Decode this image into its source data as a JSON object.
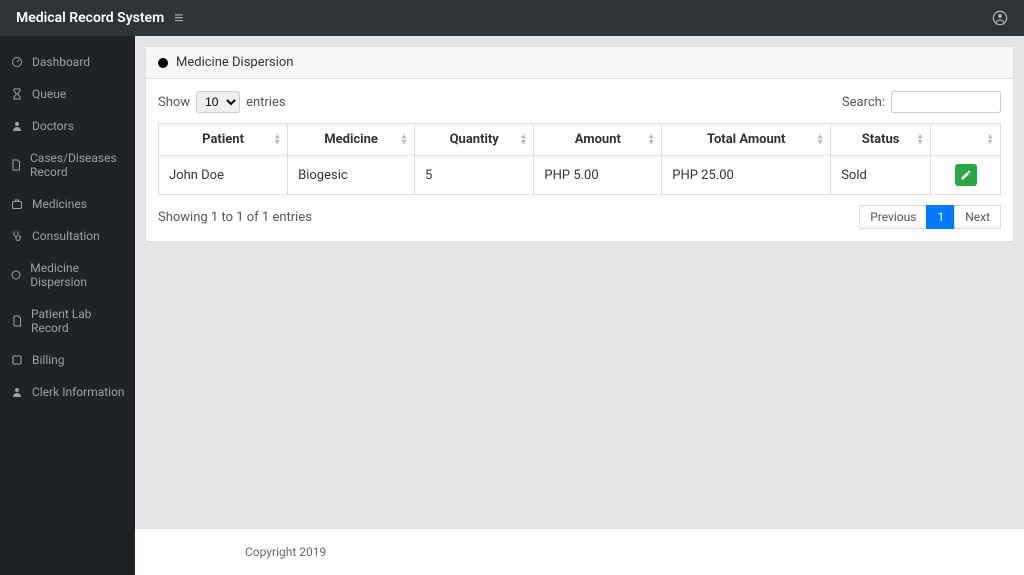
{
  "app": {
    "title": "Medical Record System"
  },
  "sidebar": {
    "items": [
      {
        "label": "Dashboard"
      },
      {
        "label": "Queue"
      },
      {
        "label": "Doctors"
      },
      {
        "label": "Cases/Diseases Record"
      },
      {
        "label": "Medicines"
      },
      {
        "label": "Consultation"
      },
      {
        "label": "Medicine Dispersion"
      },
      {
        "label": "Patient Lab Record"
      },
      {
        "label": "Billing"
      },
      {
        "label": "Clerk Information"
      }
    ]
  },
  "page": {
    "title": "Medicine Dispersion"
  },
  "table": {
    "show_label_pre": "Show",
    "show_label_post": "entries",
    "show_value": "10",
    "search_label": "Search:",
    "columns": [
      "Patient",
      "Medicine",
      "Quantity",
      "Amount",
      "Total Amount",
      "Status",
      ""
    ],
    "rows": [
      {
        "patient": "John Doe",
        "medicine": "Biogesic",
        "quantity": "5",
        "amount": "PHP 5.00",
        "total_amount": "PHP 25.00",
        "status": "Sold"
      }
    ],
    "info": "Showing 1 to 1 of 1 entries",
    "pagination": {
      "previous": "Previous",
      "next": "Next",
      "current": "1"
    }
  },
  "footer": {
    "text": "Copyright 2019"
  }
}
